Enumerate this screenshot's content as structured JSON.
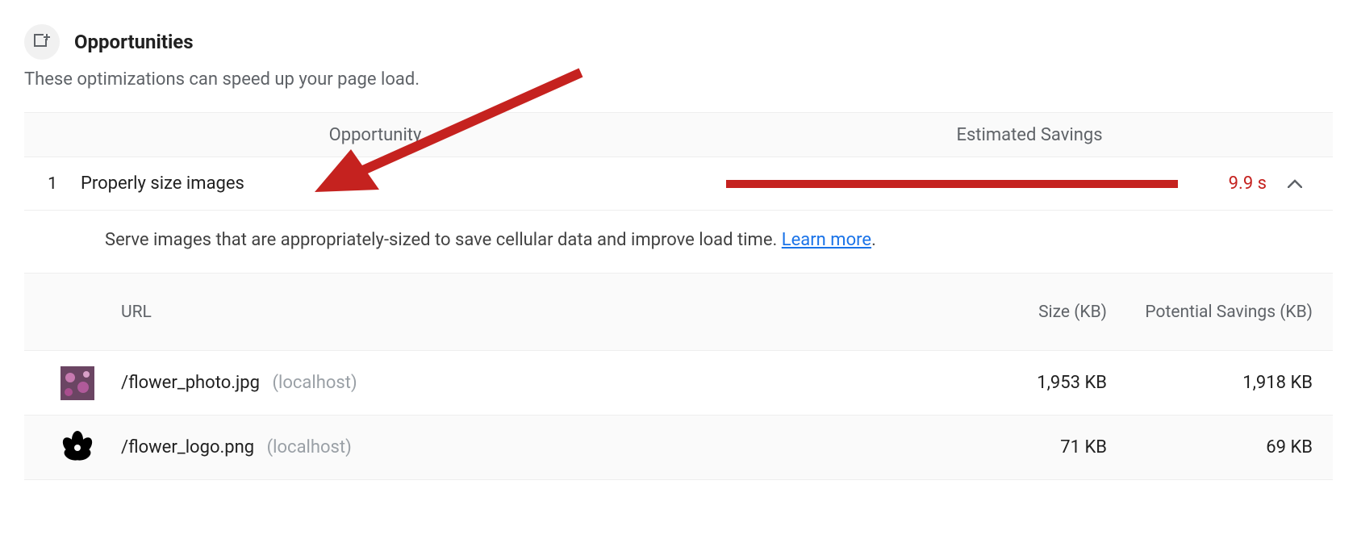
{
  "section": {
    "title": "Opportunities",
    "subtitle": "These optimizations can speed up your page load."
  },
  "columns": {
    "opportunity": "Opportunity",
    "savings": "Estimated Savings"
  },
  "opportunity": {
    "index": "1",
    "name": "Properly size images",
    "savings": "9.9 s",
    "description_prefix": "Serve images that are appropriately-sized to save cellular data and improve load time. ",
    "learn_more": "Learn more",
    "description_suffix": "."
  },
  "table": {
    "headers": {
      "url": "URL",
      "size": "Size (KB)",
      "savings": "Potential Savings (KB)"
    },
    "rows": [
      {
        "path": "/flower_photo.jpg",
        "origin": "(localhost)",
        "size": "1,953 KB",
        "savings": "1,918 KB"
      },
      {
        "path": "/flower_logo.png",
        "origin": "(localhost)",
        "size": "71 KB",
        "savings": "69 KB"
      }
    ]
  }
}
